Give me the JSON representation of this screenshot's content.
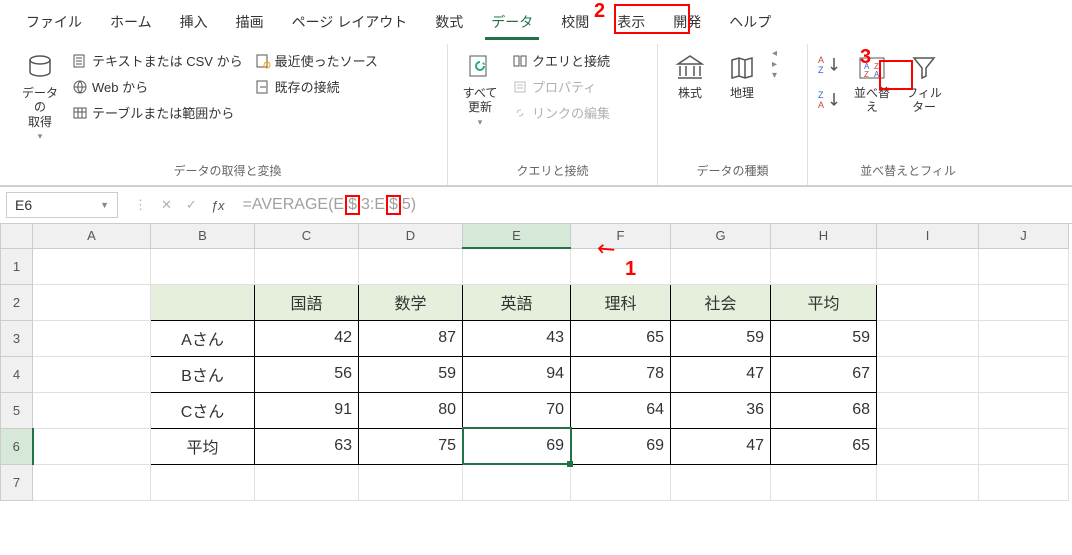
{
  "tabs": {
    "file": "ファイル",
    "home": "ホーム",
    "insert": "挿入",
    "draw": "描画",
    "layout": "ページ レイアウト",
    "formulas": "数式",
    "data": "データ",
    "review": "校閲",
    "view": "表示",
    "developer": "開発",
    "help": "ヘルプ"
  },
  "ribbon": {
    "get_data": "データの\n取得",
    "from_csv": "テキストまたは CSV から",
    "from_web": "Web から",
    "from_table": "テーブルまたは範囲から",
    "recent": "最近使ったソース",
    "existing": "既存の接続",
    "group1_label": "データの取得と変換",
    "refresh_all": "すべて\n更新",
    "queries": "クエリと接続",
    "properties": "プロパティ",
    "edit_links": "リンクの編集",
    "group2_label": "クエリと接続",
    "stocks": "株式",
    "geography": "地理",
    "group3_label": "データの種類",
    "sort": "並べ替え",
    "filter": "フィルター",
    "group4_label": "並べ替えとフィル"
  },
  "namebox": "E6",
  "formula": {
    "prefix": "=AVERAGE(E",
    "d1": "$",
    "mid1": "3:E",
    "d2": "$",
    "suffix": "5)"
  },
  "columns": [
    "A",
    "B",
    "C",
    "D",
    "E",
    "F",
    "G",
    "H",
    "I",
    "J"
  ],
  "rows": [
    "1",
    "2",
    "3",
    "4",
    "5",
    "6",
    "7"
  ],
  "table": {
    "headers": [
      "国語",
      "数学",
      "英語",
      "理科",
      "社会",
      "平均"
    ],
    "rows": [
      {
        "label": "Aさん",
        "v": [
          42,
          87,
          43,
          65,
          59,
          59
        ]
      },
      {
        "label": "Bさん",
        "v": [
          56,
          59,
          94,
          78,
          47,
          67
        ]
      },
      {
        "label": "Cさん",
        "v": [
          91,
          80,
          70,
          64,
          36,
          68
        ]
      },
      {
        "label": "平均",
        "v": [
          63,
          75,
          69,
          69,
          47,
          65
        ]
      }
    ]
  },
  "annot": {
    "n1": "1",
    "n2": "2",
    "n3": "3"
  }
}
